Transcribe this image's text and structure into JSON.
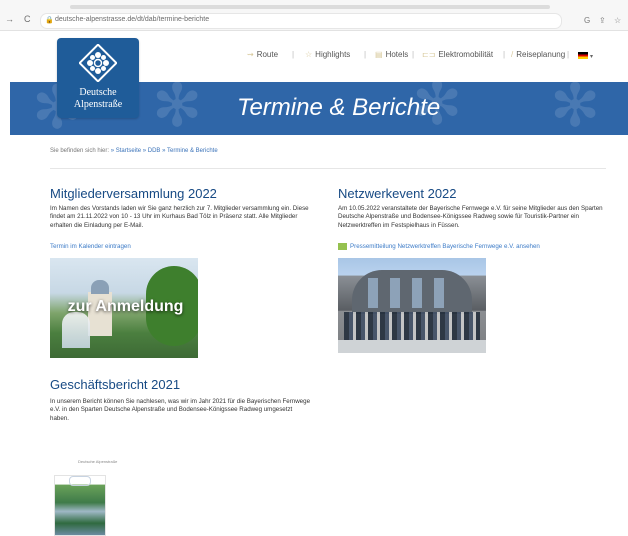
{
  "browser": {
    "url": "deutsche-alpenstrasse.de/dt/dab/termine-berichte",
    "nav": {
      "back": "→",
      "reload": "C"
    },
    "icons": [
      "translate-icon",
      "share-icon",
      "star-icon"
    ]
  },
  "logo": {
    "line1": "Deutsche",
    "line2": "Alpenstraße",
    "icon": "edelweiss-icon"
  },
  "topnav": {
    "items": [
      {
        "label": "Route",
        "icon": "route-icon"
      },
      {
        "label": "Highlights",
        "icon": "star-outline-icon"
      },
      {
        "label": "Hotels",
        "icon": "hotel-icon"
      },
      {
        "label": "Elektromobilität",
        "icon": "car-icon"
      },
      {
        "label": "Reiseplanung",
        "icon": "pen-icon"
      }
    ],
    "language_flag": "de-flag-icon"
  },
  "banner": {
    "title": "Termine & Berichte"
  },
  "breadcrumb": {
    "prefix": "Sie befinden sich hier:",
    "items": [
      "» Startseite",
      "» DDB",
      "» Termine & Berichte"
    ]
  },
  "col1": {
    "title": "Mitgliederversammlung 2022",
    "text": "Im Namen des Vorstands laden wir Sie ganz herzlich zur 7. Mitglieder versammlung ein. Diese findet am 21.11.2022 von 10 - 13 Uhr im Kurhaus Bad Tölz in Präsenz statt. Alle Mitglieder erhalten die Einladung per E-Mail.",
    "link": "Termin im Kalender eintragen",
    "image_caption": "zur Anmeldung"
  },
  "col2": {
    "title": "Netzwerkevent 2022",
    "text": "Am 10.05.2022 veranstaltete der Bayerische Fernwege e.V. für seine Mitglieder aus den Sparten Deutsche Alpenstraße und Bodensee-Königssee Radweg sowie für Touristik-Partner ein Netzwerktreffen im Festspielhaus in Füssen.",
    "link": "Pressemitteilung Netzwerktreffen Bayerische Fernwege e.V. ansehen"
  },
  "section3": {
    "title": "Geschäftsbericht 2021",
    "text": "In unserem Bericht können Sie nachlesen, was wir im Jahr 2021 für die Bayerischen Fernwege e.V. in den Sparten Deutsche Alpenstraße und Bodensee-Königssee Radweg umgesetzt haben.",
    "thumb_title": "Deutsche Alpenstraße"
  }
}
